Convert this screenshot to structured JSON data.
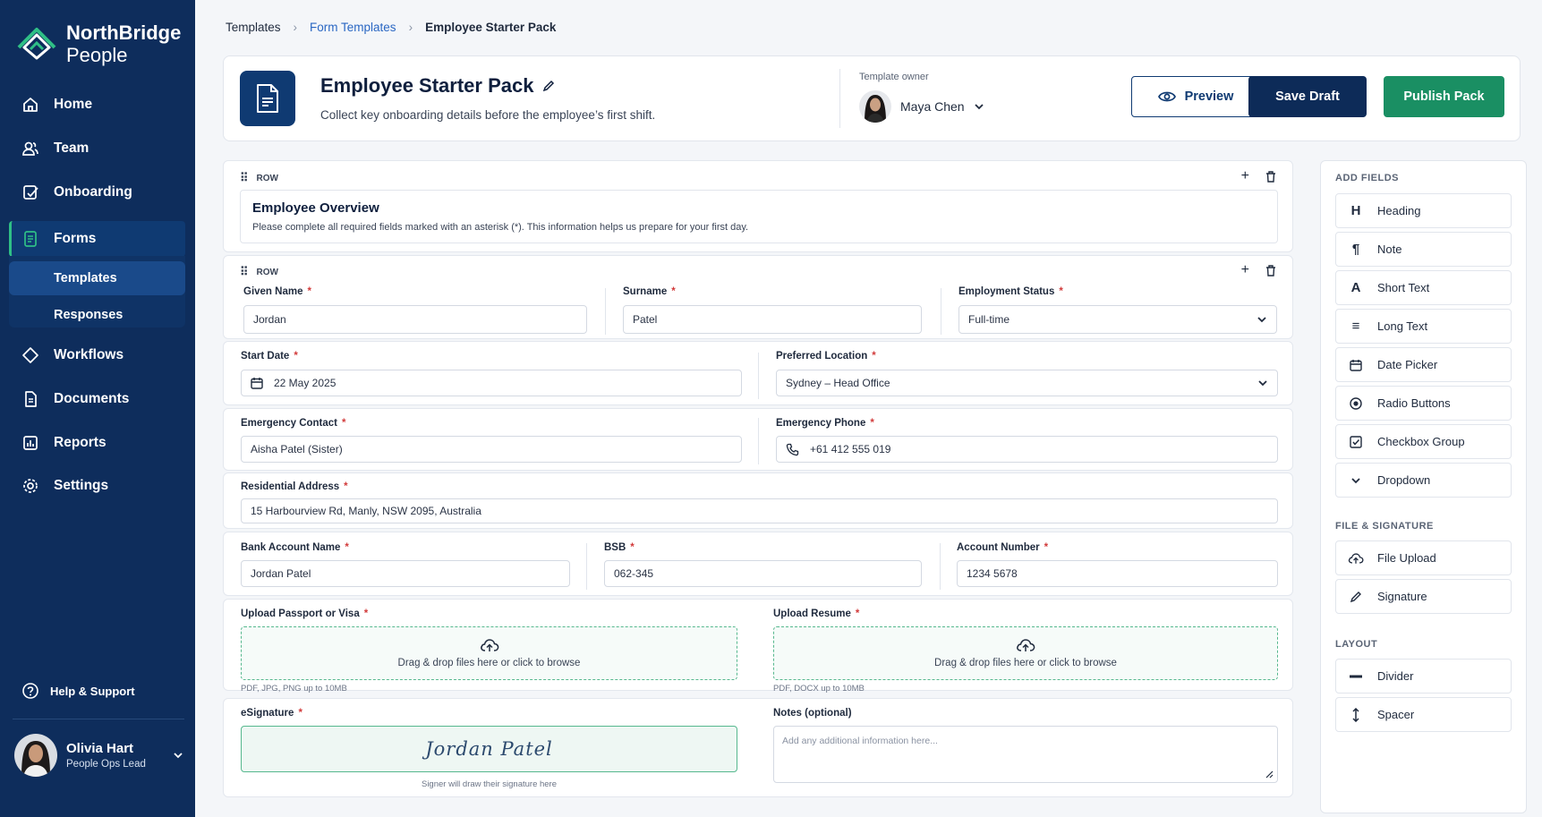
{
  "brand": {
    "name_line1": "NorthBridge",
    "name_line2": "People"
  },
  "sidebar": {
    "items": [
      {
        "label": "Home",
        "icon": "home-icon"
      },
      {
        "label": "Team",
        "icon": "team-icon"
      },
      {
        "label": "Onboarding",
        "icon": "onboarding-icon"
      },
      {
        "label": "Forms",
        "icon": "forms-icon"
      },
      {
        "label": "Workflows",
        "icon": "workflows-icon"
      },
      {
        "label": "Documents",
        "icon": "documents-icon"
      },
      {
        "label": "Reports",
        "icon": "reports-icon"
      },
      {
        "label": "Settings",
        "icon": "gear-icon"
      }
    ],
    "sub_items": [
      {
        "label": "Templates"
      },
      {
        "label": "Responses"
      }
    ],
    "help_label": "Help & Support",
    "user": {
      "name": "Olivia Hart",
      "role": "People Ops Lead"
    },
    "accent_color": "#2fbf86",
    "background_color": "#0e2d5c"
  },
  "breadcrumb": {
    "items": [
      "Templates",
      "Form Templates",
      "Employee Starter Pack"
    ]
  },
  "header": {
    "title": "Employee Starter Pack",
    "description": "Collect key onboarding details before the employee’s first shift.",
    "owner_label": "Template owner",
    "owner_name": "Maya Chen",
    "preview_label": "Preview",
    "save_label": "Save Draft",
    "publish_label": "Publish Pack",
    "publish_color": "#1a8f63",
    "save_color": "#0d2b58"
  },
  "form": {
    "row_label": "ROW",
    "overview": {
      "title": "Employee Overview",
      "description": "Please complete all required fields marked with an asterisk (*). This information helps us prepare for your first day."
    },
    "fields": {
      "given_name": {
        "label": "Given Name",
        "value": "Jordan"
      },
      "surname": {
        "label": "Surname",
        "value": "Patel"
      },
      "employment_status": {
        "label": "Employment Status",
        "value": "Full-time"
      },
      "start_date": {
        "label": "Start Date",
        "value": "22 May 2025"
      },
      "preferred_location": {
        "label": "Preferred Location",
        "value": "Sydney – Head Office"
      },
      "emergency_contact": {
        "label": "Emergency Contact",
        "value": "Aisha Patel (Sister)"
      },
      "emergency_phone": {
        "label": "Emergency Phone",
        "value": "+61 412 555 019"
      },
      "residential_address": {
        "label": "Residential Address",
        "value": "15 Harbourview Rd, Manly, NSW 2095, Australia"
      },
      "bank_account_name": {
        "label": "Bank Account Name",
        "value": "Jordan Patel"
      },
      "bsb": {
        "label": "BSB",
        "value": "062-345"
      },
      "account_number": {
        "label": "Account Number",
        "value": "1234 5678"
      },
      "upload_passport": {
        "label": "Upload Passport or Visa",
        "drop_text": "Drag & drop files here or click to browse",
        "hint": "PDF, JPG, PNG up to 10MB"
      },
      "upload_resume": {
        "label": "Upload Resume",
        "drop_text": "Drag & drop files here or click to browse",
        "hint": "PDF, DOCX up to 10MB"
      },
      "esignature": {
        "label": "eSignature",
        "signature": "Jordan Patel",
        "hint": "Signer will draw their signature here"
      },
      "notes": {
        "label": "Notes (optional)",
        "placeholder": "Add any additional information here..."
      }
    },
    "required_mark": "*"
  },
  "panel": {
    "add_fields_title": "ADD FIELDS",
    "add_fields": [
      {
        "label": "Heading",
        "icon": "heading-icon",
        "glyph": "H"
      },
      {
        "label": "Note",
        "icon": "paragraph-icon",
        "glyph": "¶"
      },
      {
        "label": "Short Text",
        "icon": "text-icon",
        "glyph": "A"
      },
      {
        "label": "Long Text",
        "icon": "long-text-icon",
        "glyph": "≡"
      },
      {
        "label": "Date Picker",
        "icon": "calendar-icon",
        "glyph": ""
      },
      {
        "label": "Radio Buttons",
        "icon": "radio-icon",
        "glyph": ""
      },
      {
        "label": "Checkbox Group",
        "icon": "checkbox-icon",
        "glyph": ""
      },
      {
        "label": "Dropdown",
        "icon": "chevron-down-icon",
        "glyph": ""
      }
    ],
    "file_sig_title": "FILE & SIGNATURE",
    "file_sig": [
      {
        "label": "File Upload",
        "icon": "cloud-upload-icon"
      },
      {
        "label": "Signature",
        "icon": "pen-icon"
      }
    ],
    "layout_title": "LAYOUT",
    "layout": [
      {
        "label": "Divider",
        "icon": "divider-icon"
      },
      {
        "label": "Spacer",
        "icon": "spacer-icon"
      }
    ]
  }
}
